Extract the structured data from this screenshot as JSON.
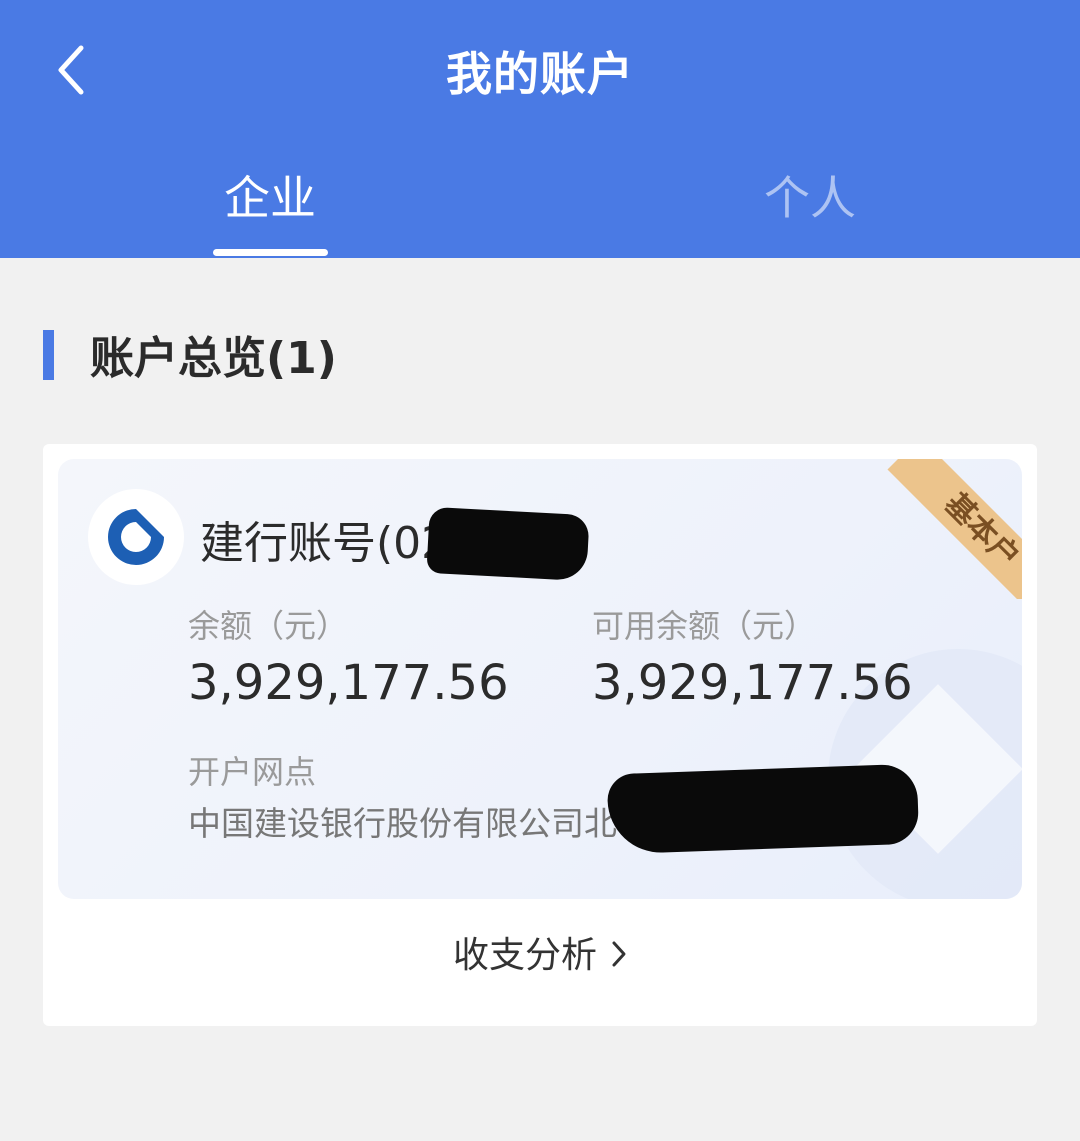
{
  "header": {
    "title": "我的账户",
    "back_icon": "chevron-left-icon",
    "tabs": [
      {
        "label": "企业",
        "active": true
      },
      {
        "label": "个人",
        "active": false
      }
    ]
  },
  "section": {
    "title": "账户总览(1)"
  },
  "account": {
    "bank_logo": "ccb-logo",
    "name": "建行账号(0211)",
    "tag": "基本户",
    "balance_label": "余额（元）",
    "balance": "3,929,177.56",
    "available_label": "可用余额（元）",
    "available": "3,929,177.56",
    "branch_label": "开户网点",
    "branch": "中国建设银行股份有限公司北"
  },
  "footer": {
    "analysis_label": "收支分析"
  },
  "colors": {
    "primary": "#4a7ae4",
    "tag_bg": "#ecc48c",
    "tag_text": "#7a4f22"
  }
}
